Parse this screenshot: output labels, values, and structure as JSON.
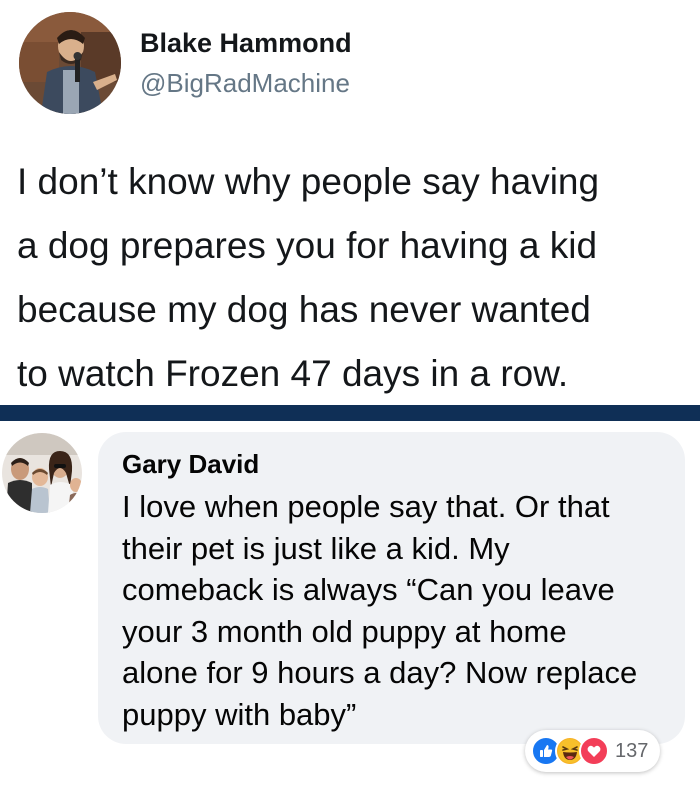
{
  "tweet": {
    "author_name": "Blake Hammond",
    "author_handle": "@BigRadMachine",
    "text_lines": [
      "I don’t know why people say having",
      "a dog prepares you for having a kid",
      "because my dog has never wanted",
      "to watch Frozen 47 days in a row."
    ]
  },
  "comment": {
    "author_name": "Gary David",
    "text_lines": [
      "I love when people say that. Or that",
      "their pet is just like a kid. My",
      "comeback is always “Can you leave",
      "your 3 month old puppy at home",
      "alone for 9 hours a day? Now replace",
      "puppy with baby”"
    ],
    "reactions": {
      "icons": [
        "like-icon",
        "haha-icon",
        "love-icon"
      ],
      "count": "137"
    }
  },
  "colors": {
    "divider": "#0f2f56",
    "bubble": "#f0f2f5",
    "like": "#1877f2",
    "love": "#f33e58",
    "haha": "#f7b125"
  }
}
